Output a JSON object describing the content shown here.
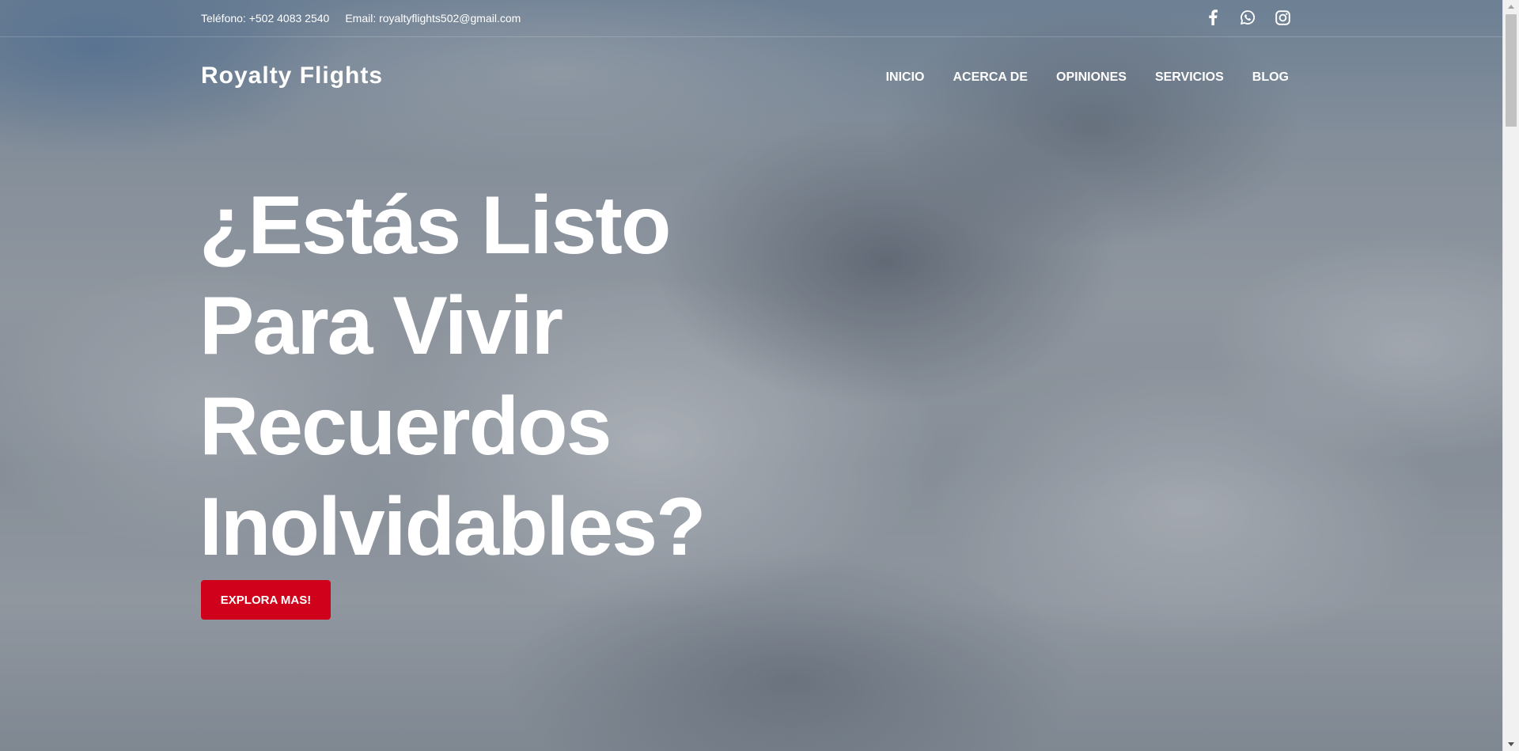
{
  "topbar": {
    "phone": "Teléfono: +502 4083 2540",
    "email": "Email: royaltyflights502@gmail.com",
    "socials": [
      {
        "name": "facebook-icon"
      },
      {
        "name": "whatsapp-icon"
      },
      {
        "name": "instagram-icon"
      }
    ]
  },
  "navbar": {
    "logo": "Royalty Flights",
    "items": [
      {
        "label": "INICIO"
      },
      {
        "label": "ACERCA DE"
      },
      {
        "label": "OPINIONES"
      },
      {
        "label": "SERVICIOS"
      },
      {
        "label": "BLOG"
      }
    ]
  },
  "hero": {
    "headline_lines": [
      "¿Estás Listo",
      "Para Vivir",
      "Recuerdos",
      "Inolvidables?"
    ],
    "cta_label": "EXPLORA MAS!"
  },
  "colors": {
    "accent": "#d0021b",
    "text": "#ffffff"
  }
}
